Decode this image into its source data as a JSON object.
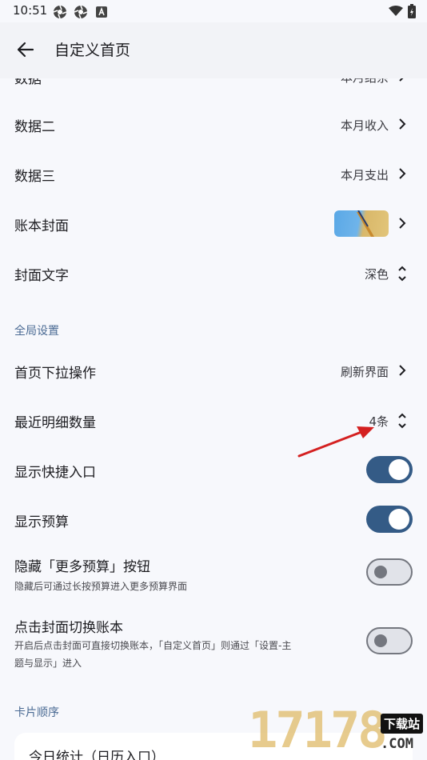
{
  "status": {
    "time": "10:51"
  },
  "app_bar": {
    "title": "自定义首页"
  },
  "rows_top": [
    {
      "label": "数据",
      "value": "本月结余"
    },
    {
      "label": "数据二",
      "value": "本月收入"
    },
    {
      "label": "数据三",
      "value": "本月支出"
    },
    {
      "label": "账本封面"
    },
    {
      "label": "封面文字",
      "value": "深色"
    }
  ],
  "section_global": "全局设置",
  "rows_global": [
    {
      "label": "首页下拉操作",
      "value": "刷新界面"
    },
    {
      "label": "最近明细数量",
      "value": "4条"
    },
    {
      "label": "显示快捷入口",
      "toggle": true
    },
    {
      "label": "显示预算",
      "toggle": true
    },
    {
      "label": "隐藏「更多预算」按钮",
      "sub": "隐藏后可通过长按预算进入更多预算界面",
      "toggle": false
    },
    {
      "label": "点击封面切换账本",
      "sub1": "开启后点击封面可直接切换账本，「自定义首页」则通过「设置-主",
      "sub2": "题与显示」进入",
      "toggle": false
    }
  ],
  "section_cards": "卡片顺序",
  "card": {
    "label": "今日统计（日历入口）"
  },
  "watermark": {
    "digits": "17178",
    "badge": "下载站",
    "suffix": ".COM"
  },
  "colors": {
    "accent": "#345b86",
    "section": "#4a6a93",
    "arrow": "#d42020"
  }
}
